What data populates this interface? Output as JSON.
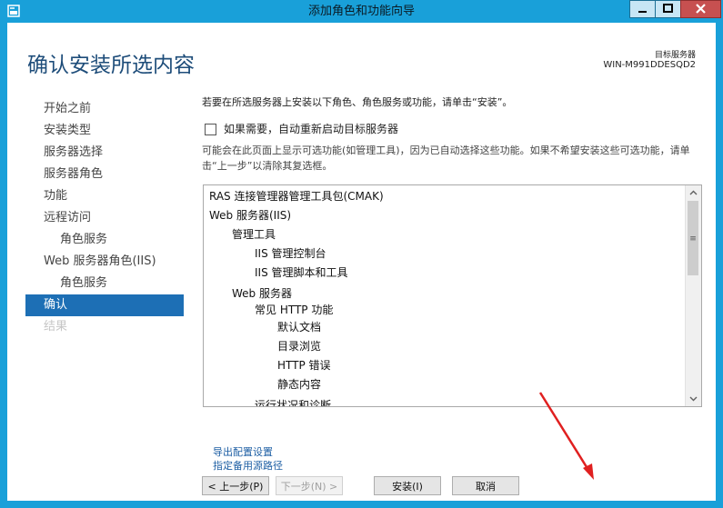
{
  "window": {
    "title": "添加角色和功能向导"
  },
  "page": {
    "title": "确认安装所选内容",
    "destination_label": "目标服务器",
    "destination_name": "WIN-M991DDESQD2"
  },
  "nav": {
    "items": [
      {
        "label": "开始之前"
      },
      {
        "label": "安装类型"
      },
      {
        "label": "服务器选择"
      },
      {
        "label": "服务器角色"
      },
      {
        "label": "功能"
      },
      {
        "label": "远程访问"
      },
      {
        "label": "角色服务"
      },
      {
        "label": "Web 服务器角色(IIS)"
      },
      {
        "label": "角色服务"
      },
      {
        "label": "确认"
      },
      {
        "label": "结果"
      }
    ]
  },
  "main": {
    "intro": "若要在所选服务器上安装以下角色、角色服务或功能，请单击“安装”。",
    "restart_label": "如果需要，自动重新启动目标服务器",
    "restart_checked": false,
    "notice": "可能会在此页面上显示可选功能(如管理工具)，因为已自动选择这些功能。如果不希望安装这些可选功能，请单击“上一步”以清除其复选框。",
    "features": [
      "RAS 连接管理器管理工具包(CMAK)",
      "Web 服务器(IIS)",
      "管理工具",
      "IIS 管理控制台",
      "IIS 管理脚本和工具",
      "Web 服务器",
      "常见 HTTP 功能",
      "默认文档",
      "目录浏览",
      "HTTP 错误",
      "静态内容",
      "运行状况和诊断"
    ],
    "export_link": "导出配置设置",
    "source_link": "指定备用源路径"
  },
  "buttons": {
    "previous": "< 上一步(P)",
    "next": "下一步(N) >",
    "install": "安装(I)",
    "cancel": "取消"
  },
  "colors": {
    "title_bar": "#19a0d9",
    "nav_active": "#1d6fb5",
    "annotation_arrow": "#e02020"
  }
}
